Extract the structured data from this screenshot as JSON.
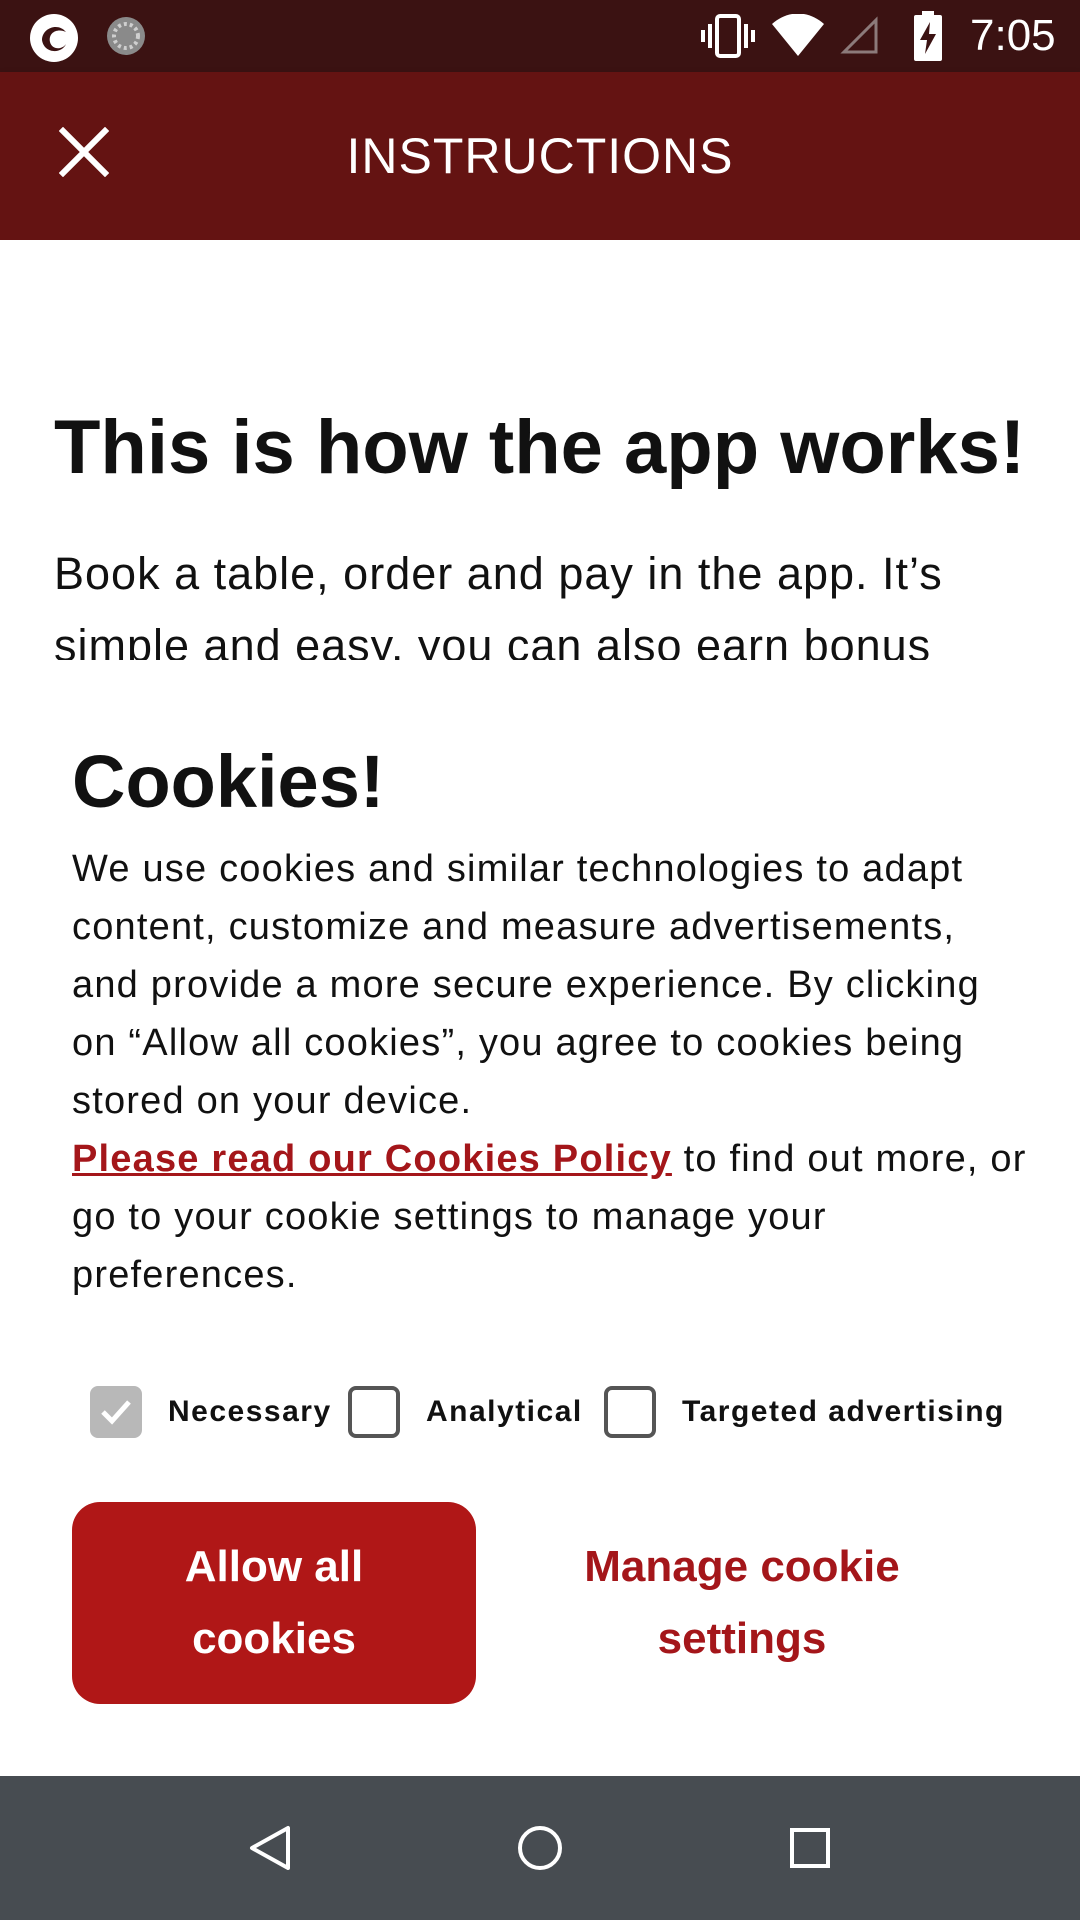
{
  "status_bar": {
    "time": "7:05",
    "icons": [
      "app-notification-icon",
      "loading-icon",
      "vibrate-icon",
      "wifi-icon",
      "signal-icon",
      "battery-charging-icon"
    ]
  },
  "app_bar": {
    "title": "INSTRUCTIONS",
    "close_icon": "close-icon"
  },
  "background": {
    "heading": "This is how the app works!",
    "text": "Book a table, order and pay in the app. It’s simple and easy, you can also earn bonus"
  },
  "cookie_banner": {
    "title": "Cookies!",
    "body": "We use cookies and similar technologies to adapt content, customize and measure advertisements, and provide a more secure experience. By clicking on “Allow all cookies”, you agree to cookies being stored on your device.",
    "policy_link": "Please read our Cookies Policy",
    "body_after_link": " to find out more, or go to your cookie settings to manage your preferences.",
    "options": [
      {
        "label": "Necessary",
        "checked": true,
        "disabled": true
      },
      {
        "label": "Analytical",
        "checked": false
      },
      {
        "label": "Targeted advertising",
        "checked": false
      }
    ],
    "allow_all_label": "Allow all cookies",
    "manage_label": "Manage cookie settings"
  },
  "colors": {
    "status_bar": "#3b1212",
    "app_bar": "#641312",
    "accent": "#b01717",
    "link": "#a4161a",
    "nav_bar": "#474c51"
  },
  "nav_bar": {
    "icons": [
      "back-icon",
      "home-icon",
      "recents-icon"
    ]
  }
}
